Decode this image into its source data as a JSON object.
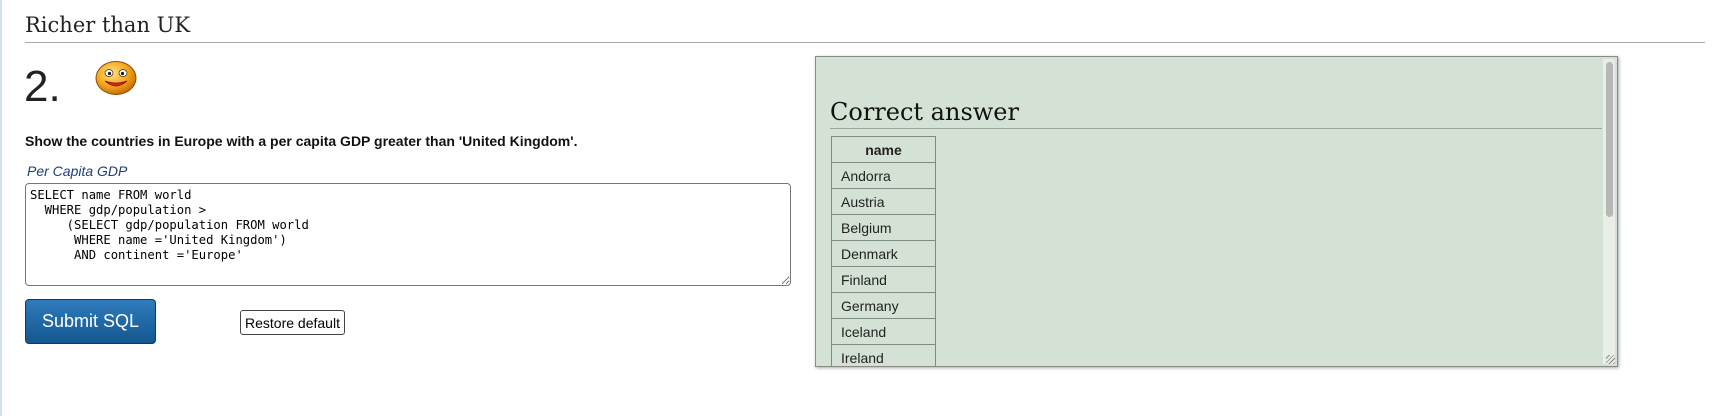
{
  "heading": "Richer than UK",
  "question": {
    "number": "2.",
    "prompt": "Show the countries in Europe with a per capita GDP greater than 'United Kingdom'.",
    "field_label": "Per Capita GDP",
    "sql": "SELECT name FROM world\n  WHERE gdp/population >\n     (SELECT gdp/population FROM world\n      WHERE name ='United Kingdom')\n      AND continent ='Europe'"
  },
  "buttons": {
    "submit_label": "Submit SQL",
    "restore_label": "Restore default"
  },
  "answer": {
    "title": "Correct answer",
    "column_header": "name",
    "rows": [
      "Andorra",
      "Austria",
      "Belgium",
      "Denmark",
      "Finland",
      "Germany",
      "Iceland",
      "Ireland"
    ]
  },
  "icons": {
    "status": "smiley-face-icon"
  },
  "colors": {
    "answer_background": "#d3e2d5",
    "submit_button": "#1f6aa8",
    "label_text": "#1d3f74"
  }
}
